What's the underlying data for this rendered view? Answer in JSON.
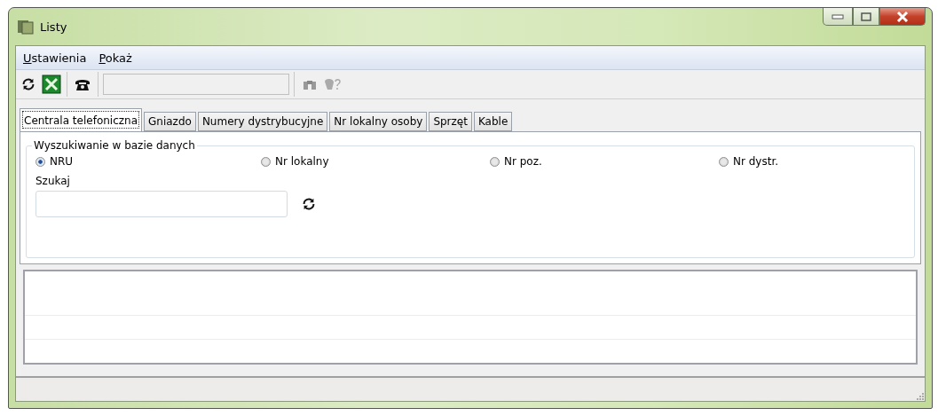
{
  "window": {
    "title": "Listy"
  },
  "menu": [
    {
      "label": "Ustawienia"
    },
    {
      "label": "Pokaż"
    }
  ],
  "tabs": [
    {
      "label": "Centrala telefoniczna",
      "selected": true
    },
    {
      "label": "Gniazdo",
      "selected": false
    },
    {
      "label": "Numery dystrybucyjne",
      "selected": false
    },
    {
      "label": "Nr lokalny osoby",
      "selected": false
    },
    {
      "label": "Sprzęt",
      "selected": false
    },
    {
      "label": "Kable",
      "selected": false
    }
  ],
  "search_group": {
    "title": "Wyszukiwanie w bazie danych",
    "options": [
      {
        "label": "NRU",
        "selected": true
      },
      {
        "label": "Nr lokalny",
        "selected": false
      },
      {
        "label": "Nr poz.",
        "selected": false
      },
      {
        "label": "Nr dystr.",
        "selected": false
      }
    ],
    "field_label": "Szukaj"
  }
}
